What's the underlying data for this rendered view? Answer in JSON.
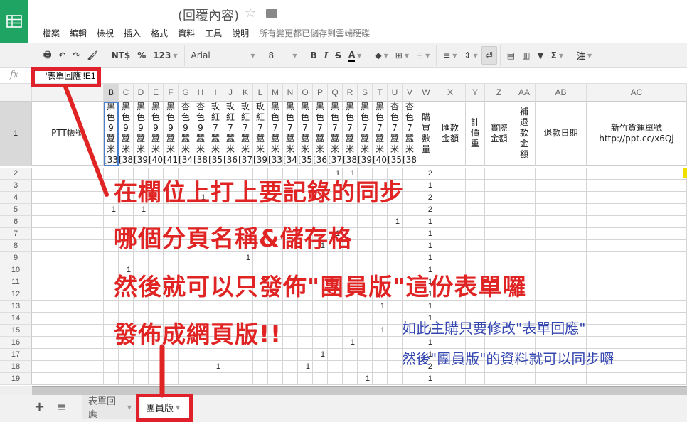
{
  "app": {
    "title": "(回覆內容)",
    "save_status": "所有變更都已儲存到雲端硬碟"
  },
  "menu": [
    "檔案",
    "編輯",
    "檢視",
    "插入",
    "格式",
    "資料",
    "工具",
    "說明"
  ],
  "toolbar": {
    "currency": "NT$",
    "percent": "%",
    "number_format": "123",
    "font": "Arial",
    "font_size": "8",
    "bold": "B",
    "italic": "I",
    "strike": "S",
    "text_color": "A",
    "sum": "Σ",
    "comment_label": "注",
    "wrap_active": true
  },
  "formula_bar": {
    "fx": "fx",
    "value": "='表單回應'!E1"
  },
  "columns": [
    {
      "letter": "A",
      "header": "PTT帳號"
    },
    {
      "letter": "B",
      "header": "黑\n色\n9\n蠶\n米\n[33"
    },
    {
      "letter": "C",
      "header": "黑\n色\n9\n蠶\n米\n[38"
    },
    {
      "letter": "D",
      "header": "黑\n色\n9\n蠶\n米\n[39"
    },
    {
      "letter": "E",
      "header": "黑\n色\n9\n蠶\n米\n[40"
    },
    {
      "letter": "F",
      "header": "黑\n色\n9\n蠶\n米\n[41"
    },
    {
      "letter": "G",
      "header": "杏\n色\n9\n蠶\n米\n[34"
    },
    {
      "letter": "H",
      "header": "杏\n色\n9\n蠶\n米\n[38"
    },
    {
      "letter": "I",
      "header": "玫\n紅\n7\n蠶\n米\n[35"
    },
    {
      "letter": "J",
      "header": "玫\n紅\n7\n蠶\n米\n[36"
    },
    {
      "letter": "K",
      "header": "玫\n紅\n7\n蠶\n米\n[37"
    },
    {
      "letter": "L",
      "header": "玫\n紅\n7\n蠶\n米\n[39"
    },
    {
      "letter": "M",
      "header": "黑\n色\n7\n蠶\n米\n[33"
    },
    {
      "letter": "N",
      "header": "黑\n色\n7\n蠶\n米\n[34"
    },
    {
      "letter": "O",
      "header": "黑\n色\n7\n蠶\n米\n[35"
    },
    {
      "letter": "P",
      "header": "黑\n色\n7\n蠶\n米\n[36"
    },
    {
      "letter": "Q",
      "header": "黑\n色\n7\n蠶\n米\n[37"
    },
    {
      "letter": "R",
      "header": "黑\n色\n7\n蠶\n米\n[38"
    },
    {
      "letter": "S",
      "header": "黑\n色\n7\n蠶\n米\n[39"
    },
    {
      "letter": "T",
      "header": "黑\n色\n7\n蠶\n米\n[40"
    },
    {
      "letter": "U",
      "header": "杏\n色\n7\n蠶\n米\n[35"
    },
    {
      "letter": "V",
      "header": "杏\n色\n7\n蠶\n米\n[38"
    },
    {
      "letter": "W",
      "header": "購\n買\n數\n量"
    },
    {
      "letter": "X",
      "header": "匯款\n金額"
    },
    {
      "letter": "Y",
      "header": "計\n價\n重"
    },
    {
      "letter": "Z",
      "header": "實際\n金額"
    },
    {
      "letter": "AA",
      "header": "補\n退\n款\n金\n額"
    },
    {
      "letter": "AB",
      "header": "退款日期"
    },
    {
      "letter": "AC",
      "header": "新竹貨運單號\nhttp://ppt.cc/x6Qj"
    }
  ],
  "rows": [
    {
      "n": "2",
      "cells": {
        "Q": "1",
        "R": "1",
        "W": "2"
      }
    },
    {
      "n": "3",
      "cells": {
        "W": "1"
      }
    },
    {
      "n": "4",
      "cells": {
        "C": "1",
        "H": "1",
        "W": "2"
      }
    },
    {
      "n": "5",
      "cells": {
        "B": "1",
        "D": "1",
        "W": "2"
      }
    },
    {
      "n": "6",
      "cells": {
        "U": "1",
        "W": "1"
      }
    },
    {
      "n": "7",
      "cells": {
        "Q": "1",
        "W": "1"
      }
    },
    {
      "n": "8",
      "cells": {
        "P": "1",
        "W": "1"
      }
    },
    {
      "n": "9",
      "cells": {
        "K": "1",
        "W": "1"
      }
    },
    {
      "n": "10",
      "cells": {
        "C": "1",
        "W": "1"
      }
    },
    {
      "n": "11",
      "cells": {
        "W": "1"
      }
    },
    {
      "n": "12",
      "cells": {
        "D": "1",
        "W": "1"
      }
    },
    {
      "n": "13",
      "cells": {
        "T": "1",
        "W": "1"
      }
    },
    {
      "n": "14",
      "cells": {
        "W": "1"
      }
    },
    {
      "n": "15",
      "cells": {
        "T": "1",
        "W": "1"
      }
    },
    {
      "n": "16",
      "cells": {
        "R": "1",
        "W": "1"
      }
    },
    {
      "n": "17",
      "cells": {
        "P": "1",
        "W": "1"
      }
    },
    {
      "n": "18",
      "cells": {
        "I": "1",
        "O": "1",
        "W": "2"
      }
    },
    {
      "n": "19",
      "cells": {
        "S": "1",
        "W": "1"
      }
    }
  ],
  "row1_label": "1",
  "selected_cell": "B1",
  "sheets": [
    {
      "name": "表單回應",
      "active": false
    },
    {
      "name": "團員版",
      "active": true
    }
  ],
  "annotations": {
    "red": [
      "在欄位上打上要記錄的同步",
      "哪個分頁名稱&儲存格",
      "然後就可以只發佈\"團員版\"這份表單囉",
      "發佈成網頁版!!"
    ],
    "blue": [
      "如此主購只要修改\"表單回應\"",
      "然後\"團員版\"的資料就可以同步囉"
    ],
    "red_color": "#e02424",
    "blue_color": "#3446b0"
  },
  "colors": {
    "brand": "#1fa463"
  }
}
